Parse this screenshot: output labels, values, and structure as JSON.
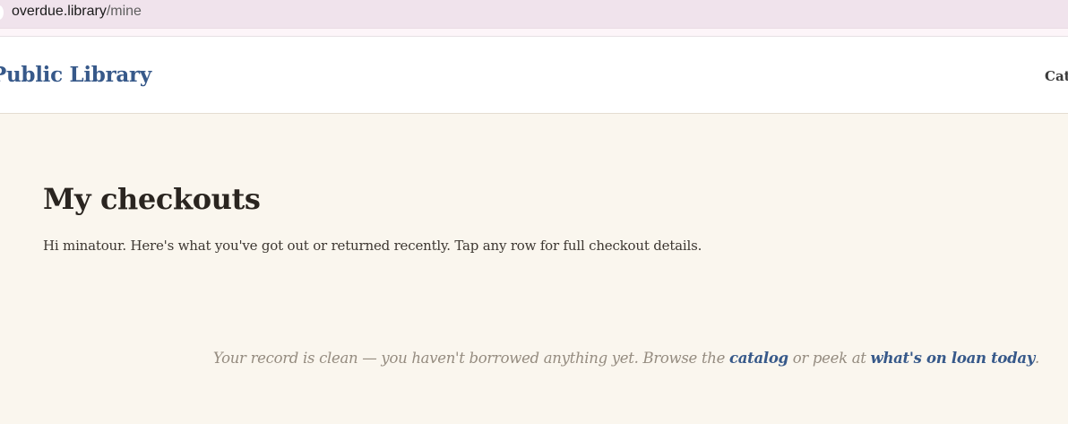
{
  "browser": {
    "url_host": "overdue.library",
    "url_path": "/mine"
  },
  "header": {
    "brand": "Public Library",
    "nav_catalog": "Cat"
  },
  "main": {
    "title": "My checkouts",
    "intro": "Hi minatour. Here's what you've got out or returned recently. Tap any row for full checkout details.",
    "empty_state": {
      "text_before": "Your record is clean — you haven't borrowed anything yet. Browse the ",
      "catalog_link": "catalog",
      "text_middle": " or peek at ",
      "on_loan_link": "what's on loan today",
      "text_after": "."
    }
  }
}
